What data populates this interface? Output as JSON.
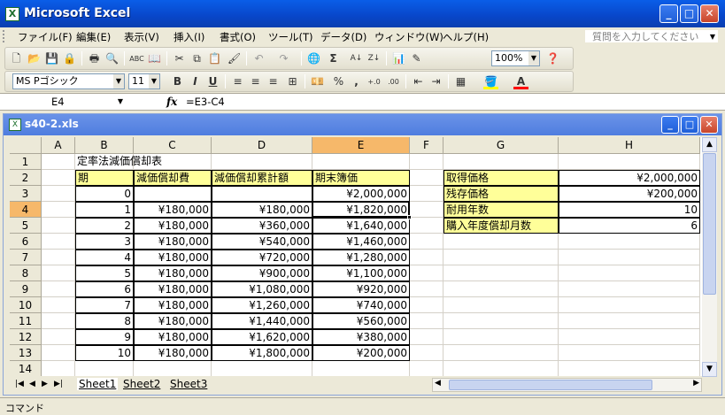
{
  "app": {
    "title": "Microsoft Excel",
    "help_placeholder": "質問を入力してください"
  },
  "menu": [
    "ファイル(F)",
    "編集(E)",
    "表示(V)",
    "挿入(I)",
    "書式(O)",
    "ツール(T)",
    "データ(D)",
    "ウィンドウ(W)",
    "ヘルプ(H)"
  ],
  "toolbar": {
    "zoom": "100%",
    "font": "MS Pゴシック",
    "size": "11"
  },
  "formula": {
    "name_box": "E4",
    "fx": "fx",
    "content": "=E3-C4"
  },
  "workbook": {
    "title": "s40-2.xls"
  },
  "columns": [
    "A",
    "B",
    "C",
    "D",
    "E",
    "F",
    "G",
    "H"
  ],
  "rows": [
    "1",
    "2",
    "3",
    "4",
    "5",
    "6",
    "7",
    "8",
    "9",
    "10",
    "11",
    "12",
    "13",
    "14"
  ],
  "sheet": {
    "title": "定率法減価償却表",
    "headers": [
      "期",
      "減価償却費",
      "減価償却累計額",
      "期末簿価"
    ],
    "data": [
      [
        "0",
        "",
        "",
        "¥2,000,000"
      ],
      [
        "1",
        "¥180,000",
        "¥180,000",
        "¥1,820,000"
      ],
      [
        "2",
        "¥180,000",
        "¥360,000",
        "¥1,640,000"
      ],
      [
        "3",
        "¥180,000",
        "¥540,000",
        "¥1,460,000"
      ],
      [
        "4",
        "¥180,000",
        "¥720,000",
        "¥1,280,000"
      ],
      [
        "5",
        "¥180,000",
        "¥900,000",
        "¥1,100,000"
      ],
      [
        "6",
        "¥180,000",
        "¥1,080,000",
        "¥920,000"
      ],
      [
        "7",
        "¥180,000",
        "¥1,260,000",
        "¥740,000"
      ],
      [
        "8",
        "¥180,000",
        "¥1,440,000",
        "¥560,000"
      ],
      [
        "9",
        "¥180,000",
        "¥1,620,000",
        "¥380,000"
      ],
      [
        "10",
        "¥180,000",
        "¥1,800,000",
        "¥200,000"
      ]
    ],
    "params": [
      [
        "取得価格",
        "¥2,000,000"
      ],
      [
        "残存価格",
        "¥200,000"
      ],
      [
        "耐用年数",
        "10"
      ],
      [
        "購入年度償却月数",
        "6"
      ]
    ]
  },
  "tabs": [
    "Sheet1",
    "Sheet2",
    "Sheet3"
  ],
  "status": "コマンド"
}
